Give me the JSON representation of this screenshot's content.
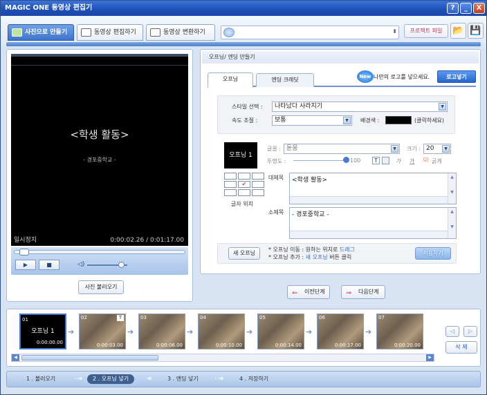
{
  "window": {
    "title": "MAGIC ONE 동영상 편집기"
  },
  "titlebar_buttons": [
    "?",
    "_",
    "X"
  ],
  "toolbar": {
    "tabs": [
      "사진으로 만들기",
      "동영상 편집하기",
      "동영상 변환하기"
    ],
    "project_file_label": "프로젝트 파일"
  },
  "preview": {
    "title_text": "<학생 활동>",
    "subtitle_text": "- 경포중학교 -",
    "status": "일시정지",
    "time": "0:00:02.26 / 0:01:17.00",
    "progress": 0.03,
    "volume": 0.85
  },
  "photo_load_button": "사진 불러오기",
  "opening": {
    "panel_title": "오프닝/ 엔딩 만들기",
    "tabs": [
      "오프닝",
      "엔딩 크레딧"
    ],
    "new_badge": "New",
    "logo_prompt": "나만의 로고를 넣으세요.",
    "logo_button": "로고넣기",
    "style_label": "스타일 선택 :",
    "style_value": "나타났다 사라지기",
    "speed_label": "속도 조절 :",
    "speed_value": "보통",
    "bg_label": "배경색 :",
    "bg_color": "#000000",
    "bg_hint": "(클릭하세요)",
    "preview_label": "오프닝 1",
    "font_label": "글꼴 :",
    "font_value": "돋움",
    "size_label": "크기 :",
    "size_value": "20",
    "opacity_label": "투명도 :",
    "opacity_value": "100",
    "format_t": "T",
    "format_ga1": "가",
    "format_ga2": "가",
    "bold_label": "굵게",
    "position_label": "글자 위치",
    "main_title_label": "대제목",
    "main_title_value": "<학생 활동>",
    "subtitle_label": "소제목",
    "subtitle_value": "- 경포중학교 -",
    "new_opening_button": "새 오프닝",
    "note1_prefix": "* 오프닝 이동 : 원하는 위치로 ",
    "note1_link": "드래그",
    "note2_prefix": "* 오프닝 추가 : ",
    "note2_link": "새 오프닝",
    "note2_suffix": " 버튼 클릭",
    "apply_button": "적용하기"
  },
  "nav": {
    "prev": "이전단계",
    "next": "다음단계"
  },
  "timeline": {
    "items": [
      {
        "num": "01",
        "label": "오프닝 1",
        "time": "0:00:00.00"
      },
      {
        "num": "02",
        "time": "0:00:03.00"
      },
      {
        "num": "03",
        "time": "0:00:06.00"
      },
      {
        "num": "04",
        "time": "0:00:10.00"
      },
      {
        "num": "05",
        "time": "0:00:14.00"
      },
      {
        "num": "06",
        "time": "0:00:17.00"
      },
      {
        "num": "07",
        "time": "0:00:20.00"
      }
    ],
    "delete_button": "삭 제"
  },
  "steps": [
    "1 . 불러오기",
    "2 . 오프닝 넣기",
    "3 . 엔딩 넣기",
    "4 . 저장하기"
  ]
}
